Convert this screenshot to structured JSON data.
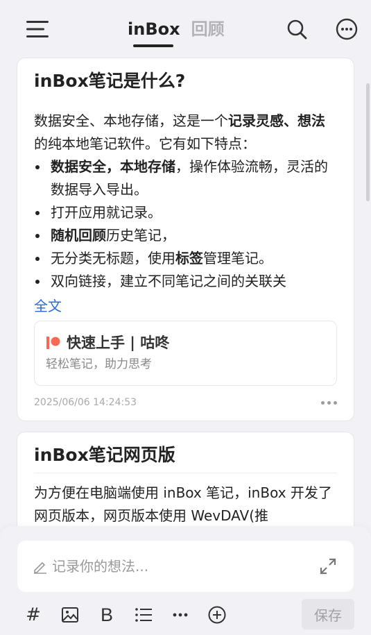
{
  "header": {
    "tabs": [
      {
        "label": "inBox",
        "active": true
      },
      {
        "label": "回顾",
        "active": false
      }
    ]
  },
  "notes": [
    {
      "title": "inBox笔记是什么?",
      "intro_parts": [
        "数据安全、本地存储，这是一个",
        "记录灵感、想法",
        "的纯本地笔记软件。它有如下特点："
      ],
      "features": [
        {
          "bold": "数据安全，本地存储",
          "rest": "，操作体验流畅，灵活的数据导入导出。"
        },
        {
          "bold": "",
          "rest": "打开应用就记录。"
        },
        {
          "bold": "随机回顾",
          "rest": "历史笔记，"
        },
        {
          "bold": "",
          "rest": "无分类无标题，使用",
          "bold2": "标签",
          "rest2": "管理笔记。"
        },
        {
          "bold": "",
          "rest": "双向链接，建立不同笔记之间的关联关"
        }
      ],
      "full_text_link": "全文",
      "link_card": {
        "title": "快速上手 | 咕咚",
        "subtitle": "轻松笔记，助力思考"
      },
      "timestamp": "2025/06/06 14:24:53"
    },
    {
      "title": "inBox笔记网页版",
      "body": "为方便在电脑端使用 inBox 笔记，inBox 开发了网页版本，网页版本使用 WevDAV(推"
    }
  ],
  "composer": {
    "placeholder": "记录你的想法..."
  },
  "toolbar": {
    "hash_label": "#",
    "bold_label": "B",
    "save_label": "保存"
  },
  "colors": {
    "background": "#f2f2f6",
    "link": "#2a6ad6",
    "patreon": "#f96854"
  }
}
